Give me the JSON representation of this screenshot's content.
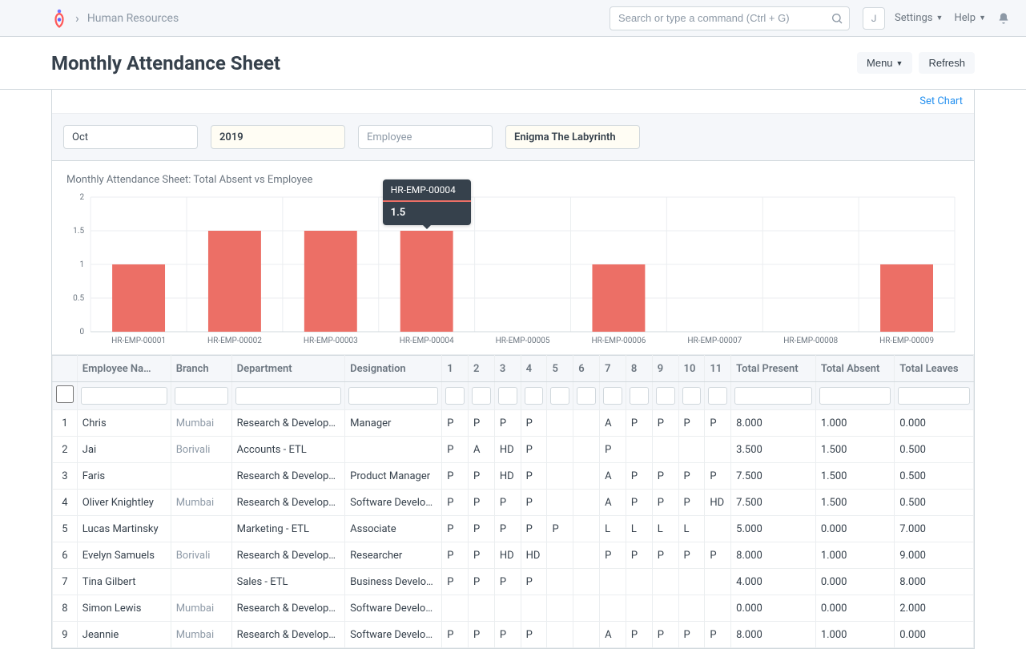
{
  "navbar": {
    "breadcrumb": "Human Resources",
    "search_placeholder": "Search or type a command (Ctrl + G)",
    "avatar_letter": "J",
    "settings_label": "Settings",
    "help_label": "Help"
  },
  "page": {
    "title": "Monthly Attendance Sheet",
    "menu_label": "Menu",
    "refresh_label": "Refresh",
    "set_chart_label": "Set Chart"
  },
  "filters": {
    "month": "Oct",
    "year": "2019",
    "employee_placeholder": "Employee",
    "company": "Enigma The Labyrinth"
  },
  "chart_data": {
    "type": "bar",
    "title": "Monthly Attendance Sheet: Total Absent vs Employee",
    "categories": [
      "HR-EMP-00001",
      "HR-EMP-00002",
      "HR-EMP-00003",
      "HR-EMP-00004",
      "HR-EMP-00005",
      "HR-EMP-00006",
      "HR-EMP-00007",
      "HR-EMP-00008",
      "HR-EMP-00009"
    ],
    "values": [
      1.0,
      1.5,
      1.5,
      1.5,
      0.0,
      1.0,
      0.0,
      0.0,
      1.0
    ],
    "ylim": [
      0,
      2
    ],
    "yticks": [
      0,
      0.5,
      1,
      1.5,
      2
    ],
    "tooltip": {
      "label": "HR-EMP-00004",
      "value": "1.5",
      "index": 3
    },
    "bar_color": "#ec6f66"
  },
  "table": {
    "columns": [
      "Employee Na…",
      "Branch",
      "Department",
      "Designation",
      "1",
      "2",
      "3",
      "4",
      "5",
      "6",
      "7",
      "8",
      "9",
      "10",
      "11",
      "Total Present",
      "Total Absent",
      "Total Leaves"
    ],
    "rows": [
      {
        "idx": "1",
        "name": "Chris",
        "branch": "Mumbai",
        "dept": "Research & Develop…",
        "desig": "Manager",
        "days": [
          "P",
          "P",
          "P",
          "P",
          "",
          "",
          "A",
          "P",
          "P",
          "P",
          "P"
        ],
        "tp": "8.000",
        "ta": "1.000",
        "tl": "0.000"
      },
      {
        "idx": "2",
        "name": "Jai",
        "branch": "Borivali",
        "dept": "Accounts - ETL",
        "desig": "",
        "days": [
          "P",
          "A",
          "HD",
          "P",
          "",
          "",
          "P",
          "",
          "",
          "",
          ""
        ],
        "tp": "3.500",
        "ta": "1.500",
        "tl": "0.500"
      },
      {
        "idx": "3",
        "name": "Faris",
        "branch": "",
        "dept": "Research & Develop…",
        "desig": "Product Manager",
        "days": [
          "P",
          "P",
          "HD",
          "P",
          "",
          "",
          "A",
          "P",
          "P",
          "P",
          "P"
        ],
        "tp": "7.500",
        "ta": "1.500",
        "tl": "0.500"
      },
      {
        "idx": "4",
        "name": "Oliver Knightley",
        "branch": "Mumbai",
        "dept": "Research & Develop…",
        "desig": "Software Develo…",
        "days": [
          "P",
          "P",
          "P",
          "P",
          "",
          "",
          "A",
          "P",
          "P",
          "P",
          "HD"
        ],
        "tp": "7.500",
        "ta": "1.500",
        "tl": "0.500"
      },
      {
        "idx": "5",
        "name": "Lucas Martinsky",
        "branch": "",
        "dept": "Marketing - ETL",
        "desig": "Associate",
        "days": [
          "P",
          "P",
          "P",
          "P",
          "P",
          "",
          "L",
          "L",
          "L",
          "L",
          ""
        ],
        "tp": "5.000",
        "ta": "0.000",
        "tl": "7.000"
      },
      {
        "idx": "6",
        "name": "Evelyn Samuels",
        "branch": "Borivali",
        "dept": "Research & Develop…",
        "desig": "Researcher",
        "days": [
          "P",
          "P",
          "HD",
          "HD",
          "",
          "",
          "P",
          "P",
          "P",
          "P",
          "P"
        ],
        "tp": "8.000",
        "ta": "1.000",
        "tl": "9.000"
      },
      {
        "idx": "7",
        "name": "Tina Gilbert",
        "branch": "",
        "dept": "Sales - ETL",
        "desig": "Business Develo…",
        "days": [
          "P",
          "P",
          "P",
          "P",
          "",
          "",
          "",
          "",
          "",
          "",
          ""
        ],
        "tp": "4.000",
        "ta": "0.000",
        "tl": "8.000"
      },
      {
        "idx": "8",
        "name": "Simon Lewis",
        "branch": "Mumbai",
        "dept": "Research & Develop…",
        "desig": "Software Develo…",
        "days": [
          "",
          "",
          "",
          "",
          "",
          "",
          "",
          "",
          "",
          "",
          ""
        ],
        "tp": "0.000",
        "ta": "0.000",
        "tl": "2.000"
      },
      {
        "idx": "9",
        "name": "Jeannie",
        "branch": "Mumbai",
        "dept": "Research & Develop…",
        "desig": "Software Develo…",
        "days": [
          "P",
          "P",
          "P",
          "P",
          "",
          "",
          "A",
          "P",
          "P",
          "P",
          "P"
        ],
        "tp": "8.000",
        "ta": "1.000",
        "tl": "0.000"
      }
    ]
  }
}
